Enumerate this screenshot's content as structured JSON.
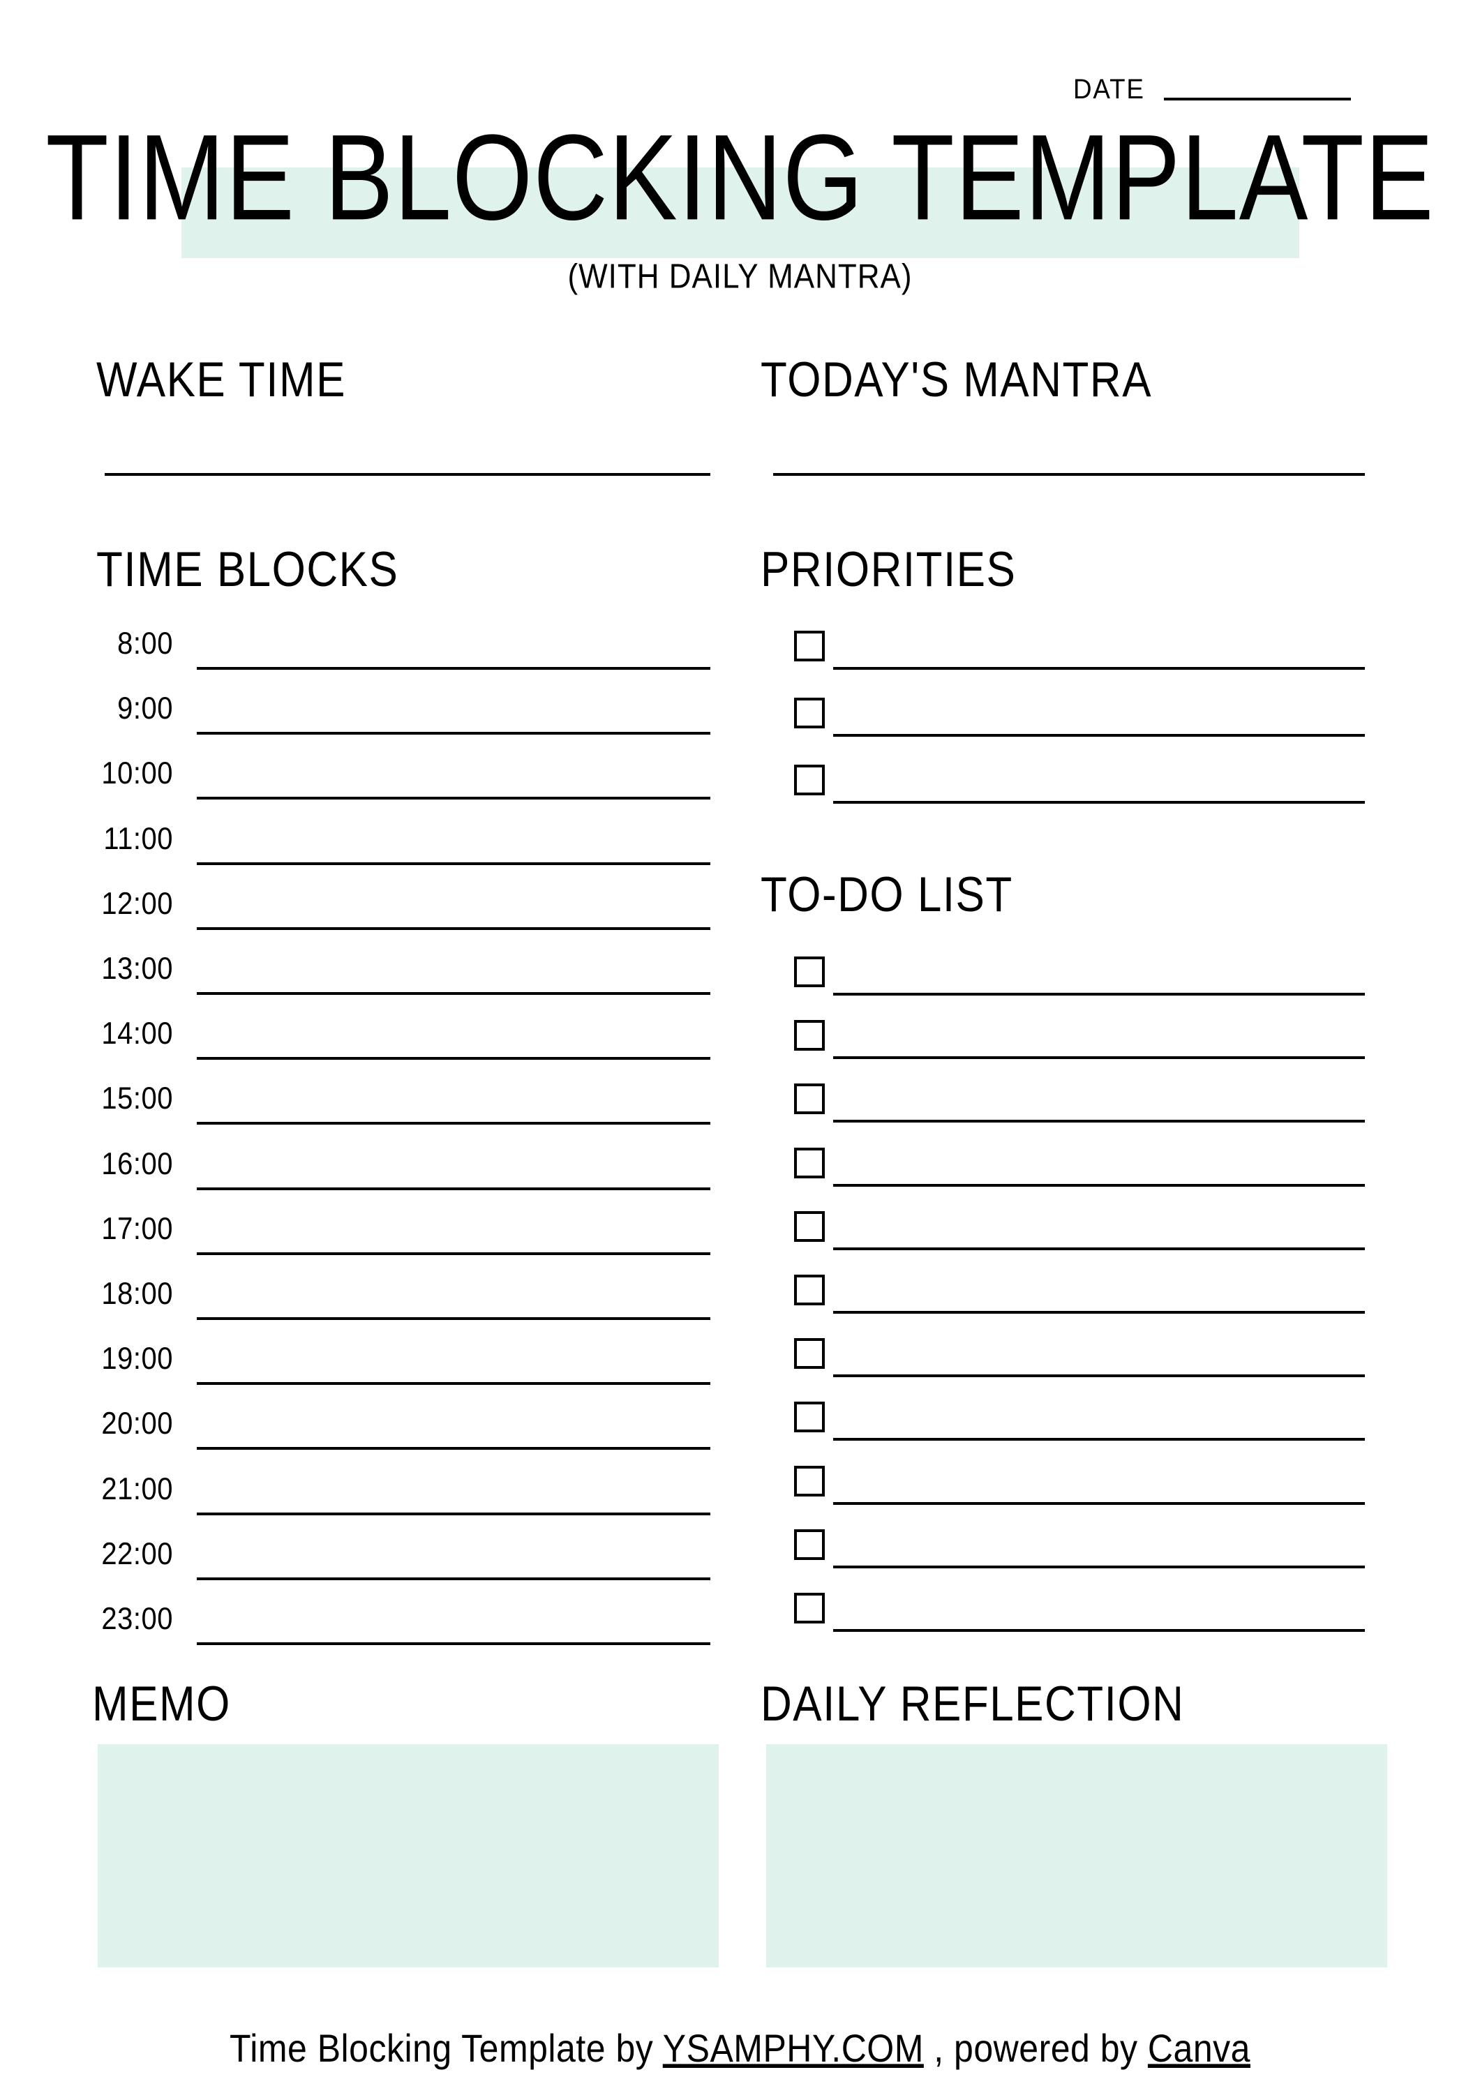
{
  "page": {
    "background": "#ffffff",
    "accent_mint": "#dff2ec",
    "ink": "#000000"
  },
  "header": {
    "date_label": "DATE",
    "title": "TIME BLOCKING TEMPLATE",
    "subtitle": "(WITH DAILY MANTRA)"
  },
  "wake_time": {
    "heading": "WAKE TIME",
    "value": ""
  },
  "mantra": {
    "heading": "TODAY'S MANTRA",
    "value": ""
  },
  "time_blocks": {
    "heading": "TIME BLOCKS",
    "rows": [
      {
        "time": "8:00",
        "value": ""
      },
      {
        "time": "9:00",
        "value": ""
      },
      {
        "time": "10:00",
        "value": ""
      },
      {
        "time": "11:00",
        "value": ""
      },
      {
        "time": "12:00",
        "value": ""
      },
      {
        "time": "13:00",
        "value": ""
      },
      {
        "time": "14:00",
        "value": ""
      },
      {
        "time": "15:00",
        "value": ""
      },
      {
        "time": "16:00",
        "value": ""
      },
      {
        "time": "17:00",
        "value": ""
      },
      {
        "time": "18:00",
        "value": ""
      },
      {
        "time": "19:00",
        "value": ""
      },
      {
        "time": "20:00",
        "value": ""
      },
      {
        "time": "21:00",
        "value": ""
      },
      {
        "time": "22:00",
        "value": ""
      },
      {
        "time": "23:00",
        "value": ""
      }
    ]
  },
  "priorities": {
    "heading": "PRIORITIES",
    "items": [
      {
        "checked": false,
        "value": ""
      },
      {
        "checked": false,
        "value": ""
      },
      {
        "checked": false,
        "value": ""
      }
    ]
  },
  "todo": {
    "heading": "TO-DO LIST",
    "items": [
      {
        "checked": false,
        "value": ""
      },
      {
        "checked": false,
        "value": ""
      },
      {
        "checked": false,
        "value": ""
      },
      {
        "checked": false,
        "value": ""
      },
      {
        "checked": false,
        "value": ""
      },
      {
        "checked": false,
        "value": ""
      },
      {
        "checked": false,
        "value": ""
      },
      {
        "checked": false,
        "value": ""
      },
      {
        "checked": false,
        "value": ""
      },
      {
        "checked": false,
        "value": ""
      },
      {
        "checked": false,
        "value": ""
      }
    ]
  },
  "memo": {
    "heading": "MEMO",
    "value": ""
  },
  "reflection": {
    "heading": "DAILY REFLECTION",
    "value": ""
  },
  "footer": {
    "text_before": "Time Blocking Template by ",
    "link1": "YSAMPHY.COM",
    "text_middle": " , powered by ",
    "link2": "Canva"
  }
}
